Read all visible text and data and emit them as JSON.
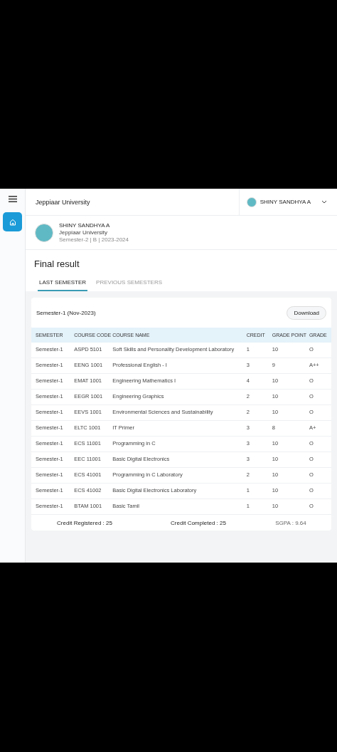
{
  "header": {
    "title": "Jeppiaar University",
    "user_name": "SHINY SANDHYA A"
  },
  "profile": {
    "name": "SHINY SANDHYA A",
    "university": "Jeppiaar University",
    "details": "Semester-2 | B | 2023-2024"
  },
  "page_title": "Final result",
  "tabs": [
    {
      "label": "LAST SEMESTER",
      "selected": true
    },
    {
      "label": "PREVIOUS SEMESTERS",
      "selected": false
    }
  ],
  "result_card": {
    "title": "Semester-1 (Nov-2023)",
    "download_label": "Download",
    "columns": [
      "SEMESTER",
      "COURSE CODE",
      "COURSE NAME",
      "CREDIT",
      "GRADE POINT",
      "GRADE"
    ],
    "rows": [
      [
        "Semester-1",
        "ASPD 5101",
        "Soft Skills and Personality Development Laboratory",
        "1",
        "10",
        "O"
      ],
      [
        "Semester-1",
        "EENG 1001",
        "Professional English - I",
        "3",
        "9",
        "A++"
      ],
      [
        "Semester-1",
        "EMAT 1001",
        "Engineering Mathematics I",
        "4",
        "10",
        "O"
      ],
      [
        "Semester-1",
        "EEGR 1001",
        "Engineering Graphics",
        "2",
        "10",
        "O"
      ],
      [
        "Semester-1",
        "EEVS 1001",
        "Environmental Sciences and Sustainability",
        "2",
        "10",
        "O"
      ],
      [
        "Semester-1",
        "ELTC 1001",
        "IT Primer",
        "3",
        "8",
        "A+"
      ],
      [
        "Semester-1",
        "ECS 11001",
        "Programming in C",
        "3",
        "10",
        "O"
      ],
      [
        "Semester-1",
        "EEC 11001",
        "Basic Digital Electronics",
        "3",
        "10",
        "O"
      ],
      [
        "Semester-1",
        "ECS 41001",
        "Programming in C Laboratory",
        "2",
        "10",
        "O"
      ],
      [
        "Semester-1",
        "ECS 41002",
        "Basic Digital Electronics Laboratory",
        "1",
        "10",
        "O"
      ],
      [
        "Semester-1",
        "BTAM 1001",
        "Basic Tamil",
        "1",
        "10",
        "O"
      ]
    ],
    "footer": {
      "credit_registered": "Credit Registered : 25",
      "credit_completed": "Credit Completed : 25",
      "sgpa": "SGPA : 9.64"
    }
  }
}
